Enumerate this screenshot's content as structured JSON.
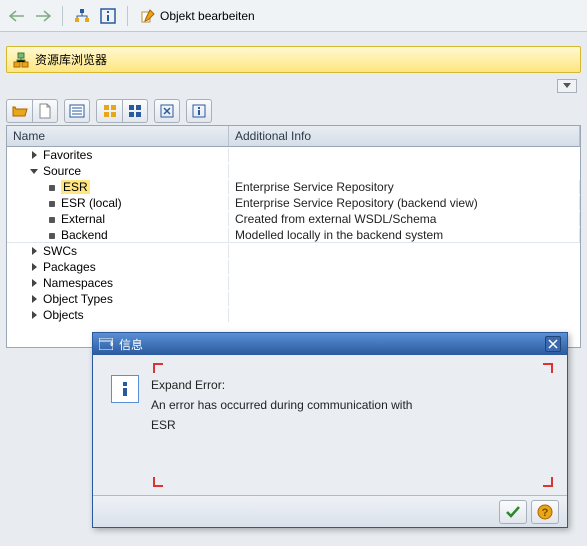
{
  "toolbar": {
    "edit_label": "Objekt bearbeiten"
  },
  "yellow_bar": {
    "title": "资源库浏览器"
  },
  "grid": {
    "columns": {
      "name": "Name",
      "info": "Additional Info"
    },
    "rows": [
      {
        "label": "Favorites",
        "level": 1,
        "exp": "collapsed",
        "info": ""
      },
      {
        "label": "Source",
        "level": 1,
        "exp": "expanded",
        "info": ""
      },
      {
        "label": "ESR",
        "level": 2,
        "exp": "leaf",
        "info": "Enterprise Service Repository",
        "highlight": true
      },
      {
        "label": "ESR (local)",
        "level": 2,
        "exp": "leaf",
        "info": "Enterprise Service Repository (backend view)"
      },
      {
        "label": "External",
        "level": 2,
        "exp": "leaf",
        "info": "Created from external WSDL/Schema"
      },
      {
        "label": "Backend",
        "level": 2,
        "exp": "leaf",
        "info": "Modelled locally in the backend system"
      },
      {
        "label": "SWCs",
        "level": 1,
        "exp": "collapsed",
        "info": ""
      },
      {
        "label": "Packages",
        "level": 1,
        "exp": "collapsed",
        "info": ""
      },
      {
        "label": "Namespaces",
        "level": 1,
        "exp": "collapsed",
        "info": ""
      },
      {
        "label": "Object Types",
        "level": 1,
        "exp": "collapsed",
        "info": ""
      },
      {
        "label": "Objects",
        "level": 1,
        "exp": "collapsed",
        "info": ""
      }
    ]
  },
  "dialog": {
    "title": "信息",
    "line1": "Expand Error:",
    "line2": "An error has occurred during communication with",
    "line3": "ESR"
  }
}
